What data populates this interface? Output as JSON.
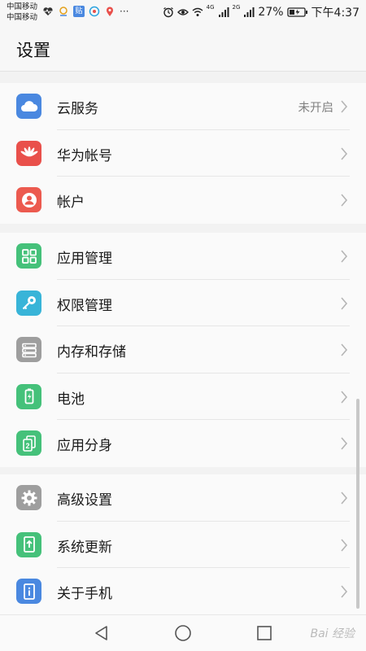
{
  "statusbar": {
    "carrier1": "中国移动",
    "carrier2": "中国移动",
    "app_badge": "贴",
    "more": "···",
    "net1": "4G",
    "net2": "2G",
    "battery": "27%",
    "time": "下午4:37"
  },
  "header": {
    "title": "设置"
  },
  "groups": [
    {
      "items": [
        {
          "label": "云服务",
          "value": "未开启",
          "icon": "cloud-icon",
          "color": "#4a88e0"
        },
        {
          "label": "华为帐号",
          "icon": "huawei-icon",
          "color": "#e9504b"
        },
        {
          "label": "帐户",
          "icon": "user-icon",
          "color": "#ec5a4f"
        }
      ]
    },
    {
      "items": [
        {
          "label": "应用管理",
          "icon": "apps-grid-icon",
          "color": "#45c17a"
        },
        {
          "label": "权限管理",
          "icon": "key-icon",
          "color": "#38b4d8"
        },
        {
          "label": "内存和存储",
          "icon": "storage-icon",
          "color": "#9e9e9e"
        },
        {
          "label": "电池",
          "icon": "battery-icon",
          "color": "#45c17a"
        },
        {
          "label": "应用分身",
          "icon": "app-twin-icon",
          "color": "#45c17a"
        }
      ]
    },
    {
      "items": [
        {
          "label": "高级设置",
          "icon": "gear-icon",
          "color": "#9e9e9e"
        },
        {
          "label": "系统更新",
          "icon": "system-update-icon",
          "color": "#45c17a"
        },
        {
          "label": "关于手机",
          "icon": "info-icon",
          "color": "#4a88e0"
        }
      ]
    }
  ],
  "navbar": {
    "watermark": "Bai 经验"
  }
}
